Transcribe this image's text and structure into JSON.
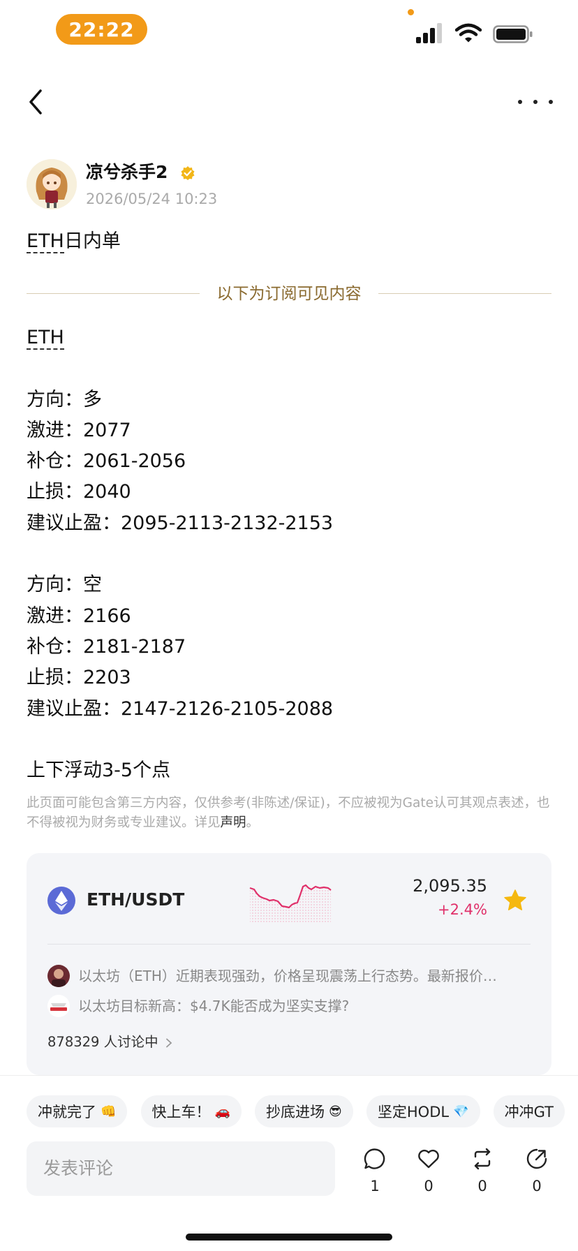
{
  "status_bar": {
    "time": "22:22"
  },
  "author": {
    "name": "凉兮杀手2",
    "time": "2026/05/24 10:23"
  },
  "post": {
    "title_ticker": "ETH",
    "title_rest": "日内单",
    "divider_label": "以下为订阅可见内容",
    "body_ticker": "ETH",
    "lines": [
      "",
      "方向：多",
      "激进：2077",
      "补仓：2061-2056",
      "止损：2040",
      "建议止盈：2095-2113-2132-2153",
      "",
      "方向：空",
      "激进：2166",
      "补仓：2181-2187",
      "止损：2203",
      "建议止盈：2147-2126-2105-2088",
      "",
      "上下浮动3-5个点"
    ]
  },
  "disclaimer": {
    "text": "此页面可能包含第三方内容，仅供参考(非陈述/保证)，不应被视为Gate认可其观点表述，也不得被视为财务或专业建议。详见",
    "link": "声明",
    "end": "。"
  },
  "market": {
    "pair": "ETH/USDT",
    "price": "2,095.35",
    "change": "+2.4%",
    "news": [
      "以太坊（ETH）近期表现强劲，价格呈现震荡上行态势。最新报价…",
      "以太坊目标新高：$4.7K能否成为坚实支撑?"
    ],
    "discussion": "878329 人讨论中",
    "colors": {
      "up": "#e0306a",
      "star": "#f5b80f",
      "logo": "#5b6ad6"
    }
  },
  "quick_replies": [
    {
      "label": "冲就完了",
      "emoji": "👊"
    },
    {
      "label": "快上车！",
      "emoji": "🚗"
    },
    {
      "label": "抄底进场",
      "emoji": "😎"
    },
    {
      "label": "坚定HODL",
      "emoji": "💎"
    },
    {
      "label": "冲冲GT",
      "emoji": ""
    }
  ],
  "comment": {
    "placeholder": "发表评论"
  },
  "actions": {
    "comments": "1",
    "likes": "0",
    "reposts": "0",
    "shares": "0"
  }
}
